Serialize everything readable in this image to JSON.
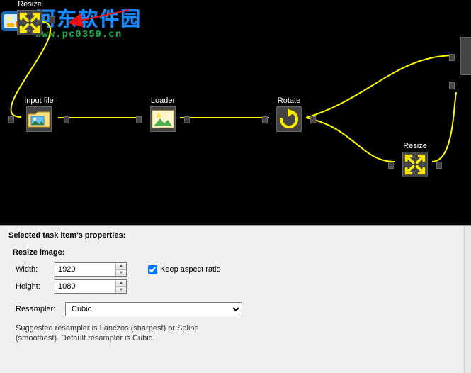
{
  "watermark": {
    "text_cn": "河东软件园",
    "url": "www.pc0359.cn"
  },
  "nodes": {
    "resize_top": {
      "label": "Resize"
    },
    "input_file": {
      "label": "Input file"
    },
    "loader": {
      "label": "Loader"
    },
    "rotate": {
      "label": "Rotate"
    },
    "resize_r": {
      "label": "Resize"
    }
  },
  "panel": {
    "header": "Selected task item's properties:",
    "group_title": "Resize image:",
    "width_label": "Width:",
    "height_label": "Height:",
    "width_value": "1920",
    "height_value": "1080",
    "aspect_label": "Keep aspect ratio",
    "aspect_checked": true,
    "resampler_label": "Resampler:",
    "resampler_value": "Cubic",
    "hint": "Suggested resampler is Lanczos (sharpest) or Spline (smoothest). Default resampler is Cubic."
  }
}
